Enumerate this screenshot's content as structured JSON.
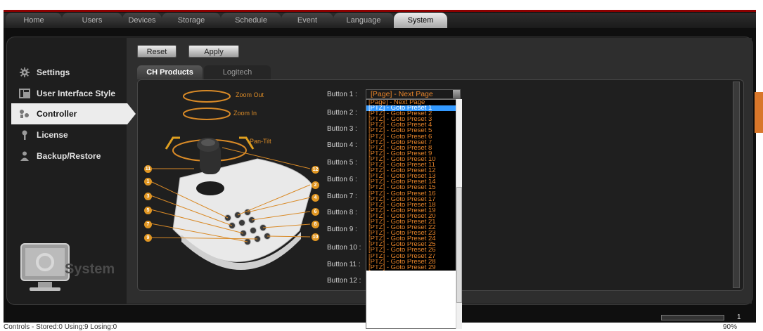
{
  "nav": {
    "tabs": [
      {
        "label": "Home"
      },
      {
        "label": "Users"
      },
      {
        "label": "Devices"
      },
      {
        "label": "Storage"
      },
      {
        "label": "Schedule"
      },
      {
        "label": "Event"
      },
      {
        "label": "Language"
      },
      {
        "label": "System"
      }
    ],
    "active": "System"
  },
  "sidebar": {
    "items": [
      {
        "label": "Settings",
        "icon": "gear-icon"
      },
      {
        "label": "User Interface Style",
        "icon": "layout-icon"
      },
      {
        "label": "Controller",
        "icon": "controller-icon"
      },
      {
        "label": "License",
        "icon": "key-icon"
      },
      {
        "label": "Backup/Restore",
        "icon": "person-icon"
      }
    ],
    "active": "Controller",
    "footer_label": "System"
  },
  "toolbar": {
    "reset_label": "Reset",
    "apply_label": "Apply"
  },
  "subtabs": [
    {
      "label": "CH Products"
    },
    {
      "label": "Logitech"
    }
  ],
  "diagram": {
    "zoom_out": "Zoom Out",
    "zoom_in": "Zoom In",
    "pan_tilt": "Pan-Tilt",
    "numbers": [
      "1",
      "2",
      "3",
      "4",
      "5",
      "6",
      "7",
      "8",
      "9",
      "10",
      "11",
      "12"
    ]
  },
  "buttons": {
    "labels": [
      "Button 1 :",
      "Button 2 :",
      "Button 3 :",
      "Button 4 :",
      "Button 5 :",
      "Button 6 :",
      "Button 7 :",
      "Button 8 :",
      "Button 9 :",
      "Button 10 :",
      "Button 11 :",
      "Button 12 :"
    ],
    "button1_value": "[Page] - Next Page"
  },
  "dropdown_options": [
    "[Page] - Next Page",
    "[PTZ] - Goto Preset 1",
    "[PTZ] - Goto Preset 2",
    "[PTZ] - Goto Preset 3",
    "[PTZ] - Goto Preset 4",
    "[PTZ] - Goto Preset 5",
    "[PTZ] - Goto Preset 6",
    "[PTZ] - Goto Preset 7",
    "[PTZ] - Goto Preset 8",
    "[PTZ] - Goto Preset 9",
    "[PTZ] - Goto Preset 10",
    "[PTZ] - Goto Preset 11",
    "[PTZ] - Goto Preset 12",
    "[PTZ] - Goto Preset 13",
    "[PTZ] - Goto Preset 14",
    "[PTZ] - Goto Preset 15",
    "[PTZ] - Goto Preset 16",
    "[PTZ] - Goto Preset 17",
    "[PTZ] - Goto Preset 18",
    "[PTZ] - Goto Preset 19",
    "[PTZ] - Goto Preset 20",
    "[PTZ] - Goto Preset 21",
    "[PTZ] - Goto Preset 22",
    "[PTZ] - Goto Preset 23",
    "[PTZ] - Goto Preset 24",
    "[PTZ] - Goto Preset 25",
    "[PTZ] - Goto Preset 26",
    "[PTZ] - Goto Preset 27",
    "[PTZ] - Goto Preset 28",
    "[PTZ] - Goto Preset 29"
  ],
  "dropdown_selected": "[PTZ] - Goto Preset 1",
  "statusbar": {
    "text": "Controls - Stored:0 Using:9 Losing:0",
    "zoom": "90%",
    "count": "1"
  },
  "colors": {
    "accent": "#e8852a",
    "selection": "#3399ff",
    "brand_red": "#8b0000"
  }
}
